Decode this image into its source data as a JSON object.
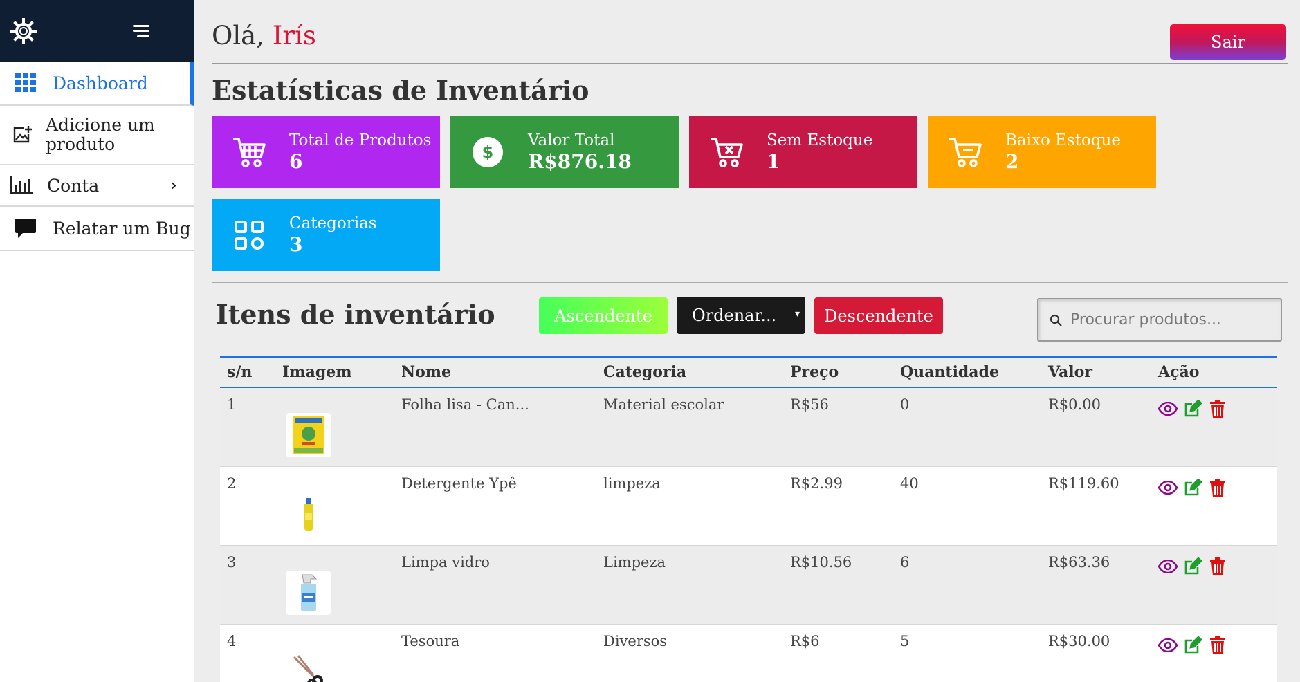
{
  "sidebar": {
    "logo": "gear-logo",
    "items": [
      {
        "label": "Dashboard",
        "icon": "grid-icon"
      },
      {
        "label": "Adicione um produto",
        "icon": "add-image-icon"
      },
      {
        "label": "Conta",
        "icon": "bar-chart-icon"
      },
      {
        "label": "Relatar um Bug",
        "icon": "chat-bubble-icon"
      }
    ]
  },
  "header": {
    "greeting": "Olá,",
    "user_name": "Irís",
    "logout_label": "Sair"
  },
  "stats": {
    "title": "Estatísticas de Inventário",
    "cards": [
      {
        "label": "Total de Produtos",
        "value": "6",
        "icon": "cart-icon",
        "color": "#b027f0"
      },
      {
        "label": "Valor Total",
        "value": "R$876.18",
        "icon": "dollar-icon",
        "color": "#359a3f"
      },
      {
        "label": "Sem Estoque",
        "value": "1",
        "icon": "cart-x-icon",
        "color": "#c51846"
      },
      {
        "label": "Baixo Estoque",
        "value": "2",
        "icon": "cart-minus-icon",
        "color": "#ffa500"
      },
      {
        "label": "Categorias",
        "value": "3",
        "icon": "categories-icon",
        "color": "#03a9f4"
      }
    ]
  },
  "inventory": {
    "title": "Itens de inventário",
    "asc_label": "Ascendente",
    "sort_label": "Ordenar...",
    "desc_label": "Descendente",
    "search_placeholder": "Procurar produtos...",
    "columns": [
      "s/n",
      "Imagem",
      "Nome",
      "Categoria",
      "Preço",
      "Quantidade",
      "Valor",
      "Ação"
    ],
    "rows": [
      {
        "sn": "1",
        "image": "folha-lisa-thumbnail",
        "name": "Folha lisa - Can...",
        "category": "Material escolar",
        "price": "R$56",
        "quantity": "0",
        "value": "R$0.00"
      },
      {
        "sn": "2",
        "image": "detergente-thumbnail",
        "name": "Detergente Ypê",
        "category": "limpeza",
        "price": "R$2.99",
        "quantity": "40",
        "value": "R$119.60"
      },
      {
        "sn": "3",
        "image": "limpa-vidro-thumbnail",
        "name": "Limpa vidro",
        "category": "Limpeza",
        "price": "R$10.56",
        "quantity": "6",
        "value": "R$63.36"
      },
      {
        "sn": "4",
        "image": "tesoura-thumbnail",
        "name": "Tesoura",
        "category": "Diversos",
        "price": "R$6",
        "quantity": "5",
        "value": "R$30.00"
      }
    ]
  },
  "colors": {
    "accent": "#1a73e8",
    "greeting_name": "#d8143a",
    "view_icon": "#8a0a8a",
    "edit_icon": "#1f9d2f",
    "delete_icon": "#e01010"
  }
}
